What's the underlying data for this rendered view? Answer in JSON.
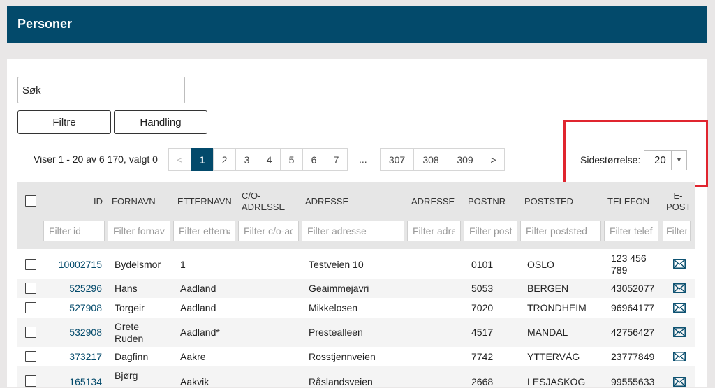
{
  "header": {
    "title": "Personer"
  },
  "search": {
    "placeholder": "Søk"
  },
  "toolbar": {
    "filter_label": "Filtre",
    "action_label": "Handling"
  },
  "results": {
    "summary": "Viser 1 - 20 av 6 170, valgt 0"
  },
  "pagination": {
    "prev": "<",
    "next": ">",
    "ellipsis": "...",
    "pages_a": [
      "1",
      "2",
      "3",
      "4",
      "5",
      "6",
      "7"
    ],
    "pages_b": [
      "307",
      "308",
      "309"
    ],
    "active": "1"
  },
  "page_size": {
    "label": "Sidestørrelse:",
    "value": "20"
  },
  "table": {
    "headers": {
      "id": "ID",
      "fornavn": "FORNAVN",
      "etternavn": "ETTERNAVN",
      "co_adresse": "C/O-ADRESSE",
      "adresse": "ADRESSE",
      "adresse2": "ADRESSE",
      "postnr": "POSTNR",
      "poststed": "POSTSTED",
      "telefon": "TELEFON",
      "epost": "E-POST"
    },
    "filters": {
      "id": "Filter id",
      "fornavn": "Filter fornavn",
      "etternavn": "Filter etternavn",
      "co_adresse": "Filter c/o-adresse",
      "adresse": "Filter adresse",
      "adresse2": "Filter adresse",
      "postnr": "Filter postnr",
      "poststed": "Filter poststed",
      "telefon": "Filter telefon",
      "epost": "Filter e-post"
    },
    "rows": [
      {
        "id": "10002715",
        "fornavn": "Bydelsmor",
        "etternavn": "1",
        "adresse": "Testveien 10",
        "postnr": "0101",
        "poststed": "OSLO",
        "telefon": "123 456 789"
      },
      {
        "id": "525296",
        "fornavn": "Hans",
        "etternavn": "Aadland",
        "adresse": "Geaimmejavri",
        "postnr": "5053",
        "poststed": "BERGEN",
        "telefon": "43052077"
      },
      {
        "id": "527908",
        "fornavn": "Torgeir",
        "etternavn": "Aadland",
        "adresse": "Mikkelosen",
        "postnr": "7020",
        "poststed": "TRONDHEIM",
        "telefon": "96964177"
      },
      {
        "id": "532908",
        "fornavn": "Grete Ruden",
        "etternavn": "Aadland*",
        "adresse": "Prestealleen",
        "postnr": "4517",
        "poststed": "MANDAL",
        "telefon": "42756427"
      },
      {
        "id": "373217",
        "fornavn": "Dagfinn",
        "etternavn": "Aakre",
        "adresse": "Rosstjennveien",
        "postnr": "7742",
        "poststed": "YTTERVÅG",
        "telefon": "23777849"
      },
      {
        "id": "165134",
        "fornavn": "Bjørg",
        "etternavn": "Aakvik",
        "adresse": "Råslandsveien",
        "postnr": "2668",
        "poststed": "LESJASKOG",
        "telefon": "99555633"
      }
    ]
  }
}
